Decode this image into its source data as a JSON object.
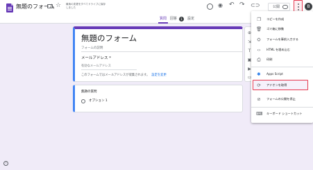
{
  "app": {
    "doc_title": "無題のフォーム",
    "save_status": "最後の変更をすべてドライブに保存しました",
    "avatar_letter": "B",
    "brand_color": "#673ab7",
    "highlight_color": "#e53950"
  },
  "toolbar": {
    "publish_label": "公開",
    "icons": [
      "folder-icon",
      "star-icon",
      "customize-theme-icon",
      "preview-icon",
      "undo-icon",
      "redo-icon",
      "link-icon",
      "lock-icon",
      "more-vert-icon"
    ]
  },
  "tabs": [
    {
      "label": "質問",
      "active": true
    },
    {
      "label": "回答",
      "badge": "1"
    },
    {
      "label": "設定"
    }
  ],
  "form": {
    "title": "無題のフォーム",
    "description_placeholder": "フォームの説明",
    "email_label": "メールアドレス *",
    "email_placeholder": "有効なメールアドレス",
    "email_note": "このフォームではメールアドレスが収集されます。",
    "email_note_link": "設定を変更"
  },
  "question": {
    "title": "無題の質問",
    "option": "オプション 1"
  },
  "menu": {
    "items": [
      {
        "icon": "copy-icon",
        "label": "コピーを作成"
      },
      {
        "icon": "trash-icon",
        "label": "ゴミ箱に移動"
      },
      {
        "icon": "person-add-icon",
        "label": "フォームを事前入力する"
      },
      {
        "icon": "code-icon",
        "label": "HTML を埋め込む"
      },
      {
        "icon": "print-icon",
        "label": "印刷"
      },
      {
        "icon": "apps-script-icon",
        "label": "Apps Script"
      },
      {
        "icon": "addon-icon",
        "label": "アドオンを取得",
        "highlighted": true
      },
      {
        "icon": "lock-publish-icon",
        "label": "フォームの公開を停止"
      },
      {
        "icon": "keyboard-icon",
        "label": "キーボード ショートカット"
      }
    ]
  }
}
